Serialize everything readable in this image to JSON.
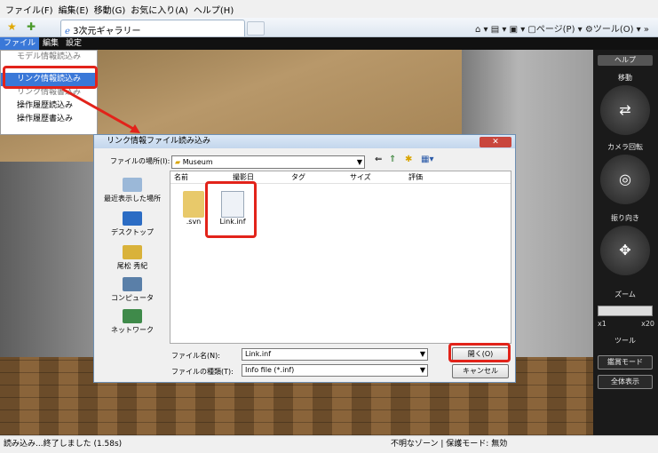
{
  "browser": {
    "menu": [
      "ファイル(F)",
      "編集(E)",
      "移動(G)",
      "お気に入り(A)",
      "ヘルプ(H)"
    ],
    "tab_title": "3次元ギャラリー",
    "right_tools": "⌂ ▾ ▤ ▾ ▣ ▾ ▢ページ(P) ▾ ⚙ツール(O) ▾ »"
  },
  "app": {
    "menu": [
      "ファイル",
      "編集",
      "設定"
    ],
    "file_menu": [
      "モデル情報読込み",
      "リンク情報読込み",
      "リンク情報書込み",
      "操作履歴読込み",
      "操作履歴書込み"
    ]
  },
  "right_panel": {
    "help": "ヘルプ",
    "move": "移動",
    "camera": "カメラ回転",
    "look": "振り向き",
    "zoom": "ズーム",
    "zoom_min": "x1",
    "zoom_max": "x20",
    "tools": "ツール",
    "appreciate_mode": "鑑賞モード",
    "show_all": "全体表示"
  },
  "dialog": {
    "title": "リンク情報ファイル読み込み",
    "look_in_label": "ファイルの場所(I):",
    "look_in_value": "Museum",
    "places": [
      "最近表示した場所",
      "デスクトップ",
      "尾松 秀紀",
      "コンピュータ",
      "ネットワーク"
    ],
    "columns": [
      "名前",
      "撮影日",
      "タグ",
      "サイズ",
      "評価"
    ],
    "files": [
      ".svn",
      "Link.inf"
    ],
    "filename_label": "ファイル名(N):",
    "filename_value": "Link.inf",
    "filetype_label": "ファイルの種類(T):",
    "filetype_value": "Info file (*.inf)",
    "open_button": "開く(O)",
    "cancel_button": "キャンセル"
  },
  "status": {
    "left": "読み込み...終了しました (1.58s)",
    "right": "不明なゾーン | 保護モード: 無効"
  }
}
